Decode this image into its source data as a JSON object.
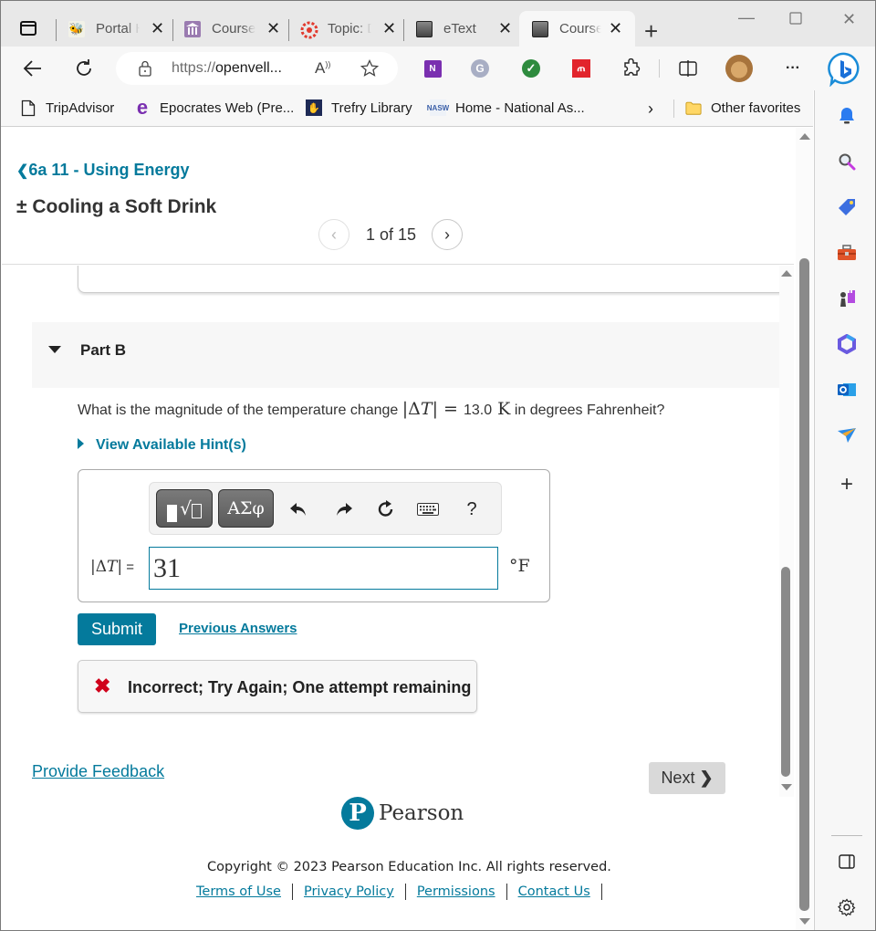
{
  "browser": {
    "tabs": [
      {
        "title": "Portal Hom",
        "favicon": "yellow-jacket-icon",
        "active": false
      },
      {
        "title": "Course Hom",
        "favicon": "university-icon",
        "active": false
      },
      {
        "title": "Topic: Disc",
        "favicon": "canvas-icon",
        "active": false
      },
      {
        "title": "eText",
        "favicon": "book-icon",
        "active": false
      },
      {
        "title": "Course Hom",
        "favicon": "book-icon",
        "active": true
      }
    ],
    "new_tab_label": "+",
    "address": {
      "protocol": "https://",
      "host": "openvell..."
    },
    "favorites": [
      {
        "label": "TripAdvisor",
        "icon": "page-icon"
      },
      {
        "label": "Epocrates Web (Pre...",
        "icon": "epocrates-icon"
      },
      {
        "label": "Trefry Library",
        "icon": "library-icon"
      },
      {
        "label": "Home - National As...",
        "icon": "nasw-icon"
      }
    ],
    "other_favorites_label": "Other favorites",
    "more_label": "···"
  },
  "page": {
    "back_link": "6a 11 - Using Energy",
    "title": "Cooling a Soft Drink",
    "title_prefix": "±",
    "pager": {
      "current": 1,
      "total": 15,
      "text": "1 of 15"
    },
    "part": {
      "label": "Part B",
      "question_pre": "What is the magnitude of the temperature change ",
      "question_math": "|ΔT| = ",
      "question_value": "13.0",
      "question_unit": "K",
      "question_post": " in degrees Fahrenheit?",
      "hint_label": "View Available Hint(s)",
      "toolbar": {
        "template_label": "√",
        "symbols_label": "ΑΣφ",
        "undo": "undo-icon",
        "redo": "redo-icon",
        "reset": "reset-icon",
        "keyboard": "keyboard-icon",
        "help_label": "?"
      },
      "answer_label_math": "|ΔT|",
      "answer_label_eq": " =",
      "answer_value": "31",
      "answer_unit": "°F",
      "submit_label": "Submit",
      "previous_answers_label": "Previous Answers",
      "feedback": {
        "status": "incorrect",
        "message": "Incorrect; Try Again; One attempt remaining",
        "color": "#d0021b"
      }
    },
    "provide_feedback_label": "Provide Feedback",
    "next_label": "Next",
    "brand": "Pearson",
    "copyright": "Copyright © 2023 Pearson Education Inc. All rights reserved.",
    "footer_links": [
      "Terms of Use",
      "Privacy Policy",
      "Permissions",
      "Contact Us"
    ]
  },
  "colors": {
    "accent": "#047a9c",
    "error": "#d0021b"
  }
}
